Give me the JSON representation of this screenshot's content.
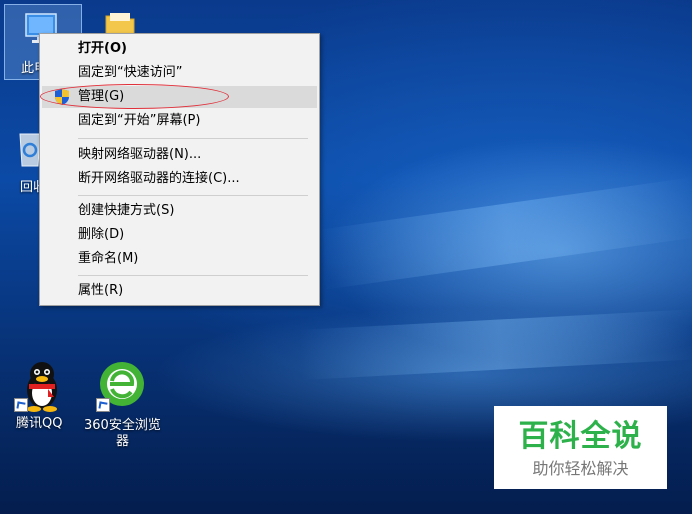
{
  "desktop": {
    "icons": {
      "this_pc": "此电",
      "folder": "",
      "recycle_bin": "回收",
      "qq": "腾讯QQ",
      "browser_line1": "360安全浏览",
      "browser_line2": "器"
    }
  },
  "context_menu": {
    "items": [
      {
        "label": "打开(O)"
      },
      {
        "label": "固定到“快速访问”"
      },
      {
        "label": "管理(G)"
      },
      {
        "label": "固定到“开始”屏幕(P)"
      },
      {
        "label": "映射网络驱动器(N)..."
      },
      {
        "label": "断开网络驱动器的连接(C)..."
      },
      {
        "label": "创建快捷方式(S)"
      },
      {
        "label": "删除(D)"
      },
      {
        "label": "重命名(M)"
      },
      {
        "label": "属性(R)"
      }
    ],
    "highlighted_item": "管理(G)"
  },
  "watermark": {
    "title": "百科全说",
    "subtitle": "助你轻松解决"
  },
  "colors": {
    "annotation_ellipse": "#e0303a",
    "watermark_green": "#2db24b"
  }
}
